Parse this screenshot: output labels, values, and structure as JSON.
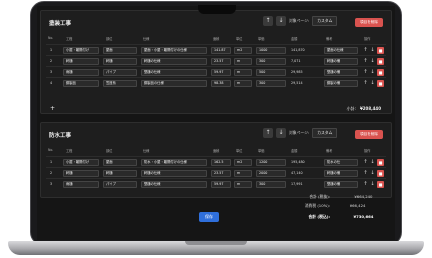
{
  "section1": {
    "title": "塗装工事",
    "page_label": "対象ページ:",
    "page_value": "カスタム",
    "delete_label": "項目を削除",
    "headers": [
      "No.",
      "工程",
      "部位",
      "仕様",
      "面積",
      "単位",
      "単価",
      "金額",
      "備考",
      "操作"
    ],
    "rows": [
      {
        "no": "1",
        "process": "小屋・離隔付け",
        "part": "屋面",
        "spec": "屋面・小屋・離隔付けの仕様",
        "area": "141.87",
        "unit": "m2",
        "price": "1000",
        "amount": "141,870",
        "note": "屋面の仕様"
      },
      {
        "no": "2",
        "process": "軒樋",
        "part": "軒樋",
        "spec": "軒樋の仕様",
        "area": "23.57",
        "unit": "m",
        "price": "300",
        "amount": "7,071",
        "note": "軒樋の備"
      },
      {
        "no": "3",
        "process": "雨樋",
        "part": "パイプ",
        "spec": "堅樋の仕様",
        "area": "59.97",
        "unit": "m",
        "price": "500",
        "amount": "29,985",
        "note": "堅樋の備"
      },
      {
        "no": "4",
        "process": "鋼製品",
        "part": "笠座系",
        "spec": "鋼製品の仕様",
        "area": "98.38",
        "unit": "m",
        "price": "300",
        "amount": "29,514",
        "note": "鋼製の備"
      }
    ],
    "subtotal_label": "小計:",
    "subtotal_value": "¥208,440"
  },
  "section2": {
    "title": "防水工事",
    "page_label": "対象ページ:",
    "page_value": "カスタム",
    "delete_label": "項目を削除",
    "headers": [
      "No.",
      "工程",
      "部位",
      "仕様",
      "面積",
      "単位",
      "単価",
      "金額",
      "備考",
      "操作"
    ],
    "rows": [
      {
        "no": "1",
        "process": "小屋・離隔付け",
        "part": "屋面",
        "spec": "防水・小屋・離隔付けの仕様",
        "area": "162.5",
        "unit": "m2",
        "price": "1200",
        "amount": "195,480",
        "note": "防水の仕"
      },
      {
        "no": "2",
        "process": "軒樋",
        "part": "軒樋",
        "spec": "軒樋の仕様",
        "area": "23.57",
        "unit": "m",
        "price": "2000",
        "amount": "47,140",
        "note": "軒樋の備"
      },
      {
        "no": "3",
        "process": "雨樋",
        "part": "パイプ",
        "spec": "堅樋の仕様",
        "area": "59.97",
        "unit": "m",
        "price": "300",
        "amount": "17,991",
        "note": "堅樋の備"
      }
    ]
  },
  "summary": {
    "total_label": "合計 (税抜):",
    "total_value": "¥664,240",
    "tax_label": "消費税 (10%):",
    "tax_value": "¥66,424",
    "grand_label": "合計 (税込):",
    "grand_value": "¥730,664"
  },
  "save_label": "保存"
}
